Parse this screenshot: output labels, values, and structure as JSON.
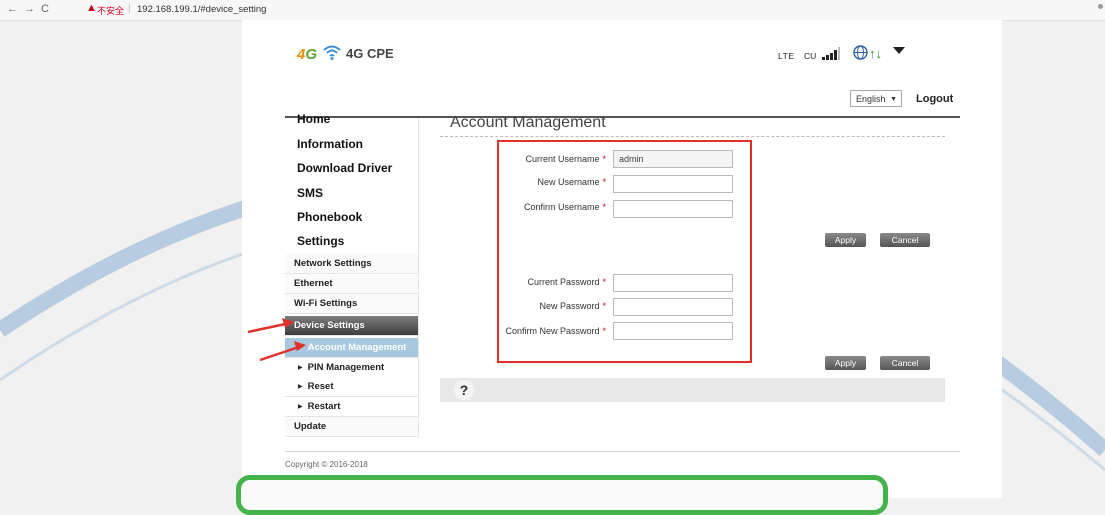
{
  "browser": {
    "security_label": "不安全",
    "url": "192.168.199.1/#device_setting"
  },
  "header": {
    "logo_prefix": "4G",
    "brand": "4G CPE",
    "network_type": "LTE",
    "carrier": "CU",
    "language": "English",
    "logout_label": "Logout"
  },
  "nav": {
    "top_items": [
      {
        "label": "Home"
      },
      {
        "label": "Information"
      },
      {
        "label": "Download Driver"
      },
      {
        "label": "SMS"
      },
      {
        "label": "Phonebook"
      },
      {
        "label": "Settings"
      }
    ],
    "sub_items": [
      {
        "label": "Network Settings"
      },
      {
        "label": "Ethernet"
      },
      {
        "label": "Wi-Fi Settings"
      },
      {
        "label": "Device Settings"
      }
    ],
    "leaf_items": [
      {
        "label": "Account Management"
      },
      {
        "label": "PIN Management"
      },
      {
        "label": "Reset"
      },
      {
        "label": "Restart"
      }
    ],
    "tail_item": "Update"
  },
  "content": {
    "title": "Account Management",
    "username_fields": [
      {
        "label": "Current Username",
        "value": "admin"
      },
      {
        "label": "New Username",
        "value": ""
      },
      {
        "label": "Confirm Username",
        "value": ""
      }
    ],
    "password_fields": [
      {
        "label": "Current Password",
        "value": ""
      },
      {
        "label": "New Password",
        "value": ""
      },
      {
        "label": "Confirm New Password",
        "value": ""
      }
    ],
    "required_mark": "*",
    "apply_label": "Apply",
    "cancel_label": "Cancel",
    "help_glyph": "?"
  },
  "footer": {
    "copyright": "Copyright © 2016-2018"
  },
  "colors": {
    "highlight_red": "#e0312b",
    "annotation_green": "#43b34a",
    "deco_arc": "#adc6dd",
    "active_leaf": "#a8c8de"
  }
}
